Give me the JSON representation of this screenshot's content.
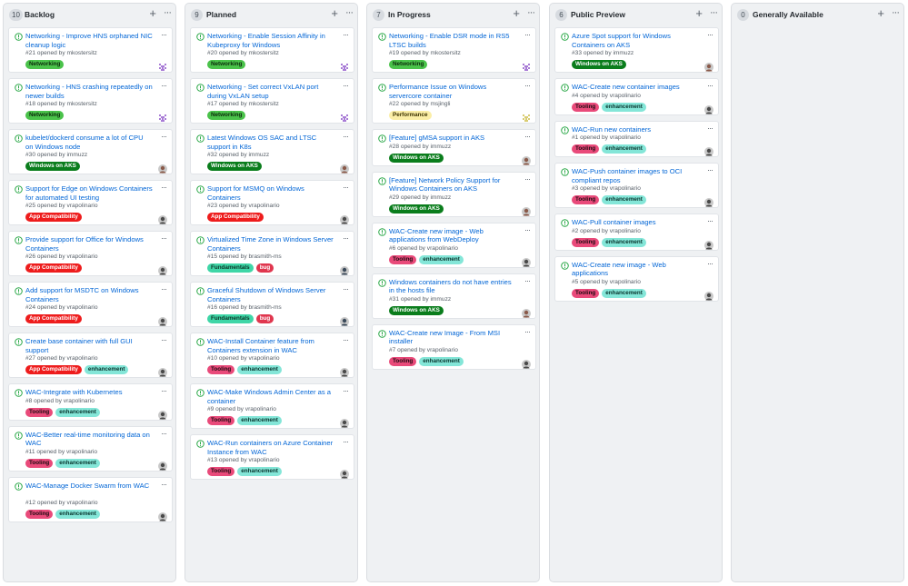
{
  "colors": {
    "link": "#0366d6",
    "open_icon": "#28a745",
    "column_bg": "#eff1f3"
  },
  "icons": {
    "open_issue": "issue-opened-icon",
    "add": "plus-icon",
    "more": "kebab-horizontal-icon"
  },
  "labels": {
    "Networking": {
      "bg": "#4ac24a",
      "fg": "#0b2a0b"
    },
    "Windows on AKS": {
      "bg": "#0a7d1c",
      "fg": "#ffffff"
    },
    "App Compatibility": {
      "bg": "#ee1c1c",
      "fg": "#ffffff"
    },
    "Tooling": {
      "bg": "#e94a7a",
      "fg": "#1b0a10"
    },
    "enhancement": {
      "bg": "#84e6d8",
      "fg": "#08332c"
    },
    "Fundamentals": {
      "bg": "#3fd6a7",
      "fg": "#0b3326"
    },
    "bug": {
      "bg": "#e0364e",
      "fg": "#ffffff"
    },
    "Performance": {
      "bg": "#fbeea6",
      "fg": "#3b3100"
    }
  },
  "columns": [
    {
      "title": "Backlog",
      "count": "10",
      "add_icon": "+",
      "menu_icon": "···",
      "cards": [
        {
          "title": "Networking - Improve HNS orphaned NIC cleanup logic",
          "meta": "#21 opened by mkostersitz",
          "labels": [
            "Networking"
          ],
          "avatar": "identicon-purple"
        },
        {
          "title": "Networking - HNS crashing repeatedly on newer builds",
          "meta": "#18 opened by mkostersitz",
          "labels": [
            "Networking"
          ],
          "avatar": "identicon-purple"
        },
        {
          "title": "kubelet/dockerd consume a lot of CPU on Windows node",
          "meta": "#30 opened by immuzz",
          "labels": [
            "Windows on AKS"
          ],
          "avatar": "photo-immuzz"
        },
        {
          "title": "Support for Edge on Windows Containers for automated UI testing",
          "meta": "#25 opened by vrapolinario",
          "labels": [
            "App Compatibility"
          ],
          "avatar": "photo-vrapolinario"
        },
        {
          "title": "Provide support for Office for Windows Containers",
          "meta": "#26 opened by vrapolinario",
          "labels": [
            "App Compatibility"
          ],
          "avatar": "photo-vrapolinario"
        },
        {
          "title": "Add support for MSDTC on Windows Containers",
          "meta": "#24 opened by vrapolinario",
          "labels": [
            "App Compatibility"
          ],
          "avatar": "photo-vrapolinario"
        },
        {
          "title": "Create base container with full GUI support",
          "meta": "#27 opened by vrapolinario",
          "labels": [
            "App Compatibility",
            "enhancement"
          ],
          "avatar": "photo-vrapolinario"
        },
        {
          "title": "WAC-Integrate with Kubernetes",
          "meta": "#8 opened by vrapolinario",
          "labels": [
            "Tooling",
            "enhancement"
          ],
          "avatar": "photo-vrapolinario"
        },
        {
          "title": "WAC-Better real-time monitoring data on WAC",
          "meta": "#11 opened by vrapolinario",
          "labels": [
            "Tooling",
            "enhancement"
          ],
          "avatar": "photo-vrapolinario"
        },
        {
          "title": "WAC-Manage Docker Swarm from WAC",
          "meta": "#12 opened by vrapolinario",
          "labels": [
            "Tooling",
            "enhancement"
          ],
          "avatar": "photo-vrapolinario"
        }
      ]
    },
    {
      "title": "Planned",
      "count": "9",
      "add_icon": "+",
      "menu_icon": "···",
      "cards": [
        {
          "title": "Networking - Enable Session Affinity in Kubeproxy for Windows",
          "meta": "#20 opened by mkostersitz",
          "labels": [
            "Networking"
          ],
          "avatar": "identicon-purple"
        },
        {
          "title": "Networking - Set correct VxLAN port during VxLAN setup",
          "meta": "#17 opened by mkostersitz",
          "labels": [
            "Networking"
          ],
          "avatar": "identicon-purple"
        },
        {
          "title": "Latest Windows OS SAC and LTSC support in K8s",
          "meta": "#32 opened by immuzz",
          "labels": [
            "Windows on AKS"
          ],
          "avatar": "photo-immuzz"
        },
        {
          "title": "Support for MSMQ on Windows Containers",
          "meta": "#23 opened by vrapolinario",
          "labels": [
            "App Compatibility"
          ],
          "avatar": "photo-vrapolinario"
        },
        {
          "title": "Virtualized Time Zone in Windows Server Containers",
          "meta": "#15 opened by brasmith-ms",
          "labels": [
            "Fundamentals",
            "bug"
          ],
          "avatar": "photo-brasmith"
        },
        {
          "title": "Graceful Shutdown of Windows Server Containers",
          "meta": "#16 opened by brasmith-ms",
          "labels": [
            "Fundamentals",
            "bug"
          ],
          "avatar": "photo-brasmith"
        },
        {
          "title": "WAC-Install Container feature from Containers extension in WAC",
          "meta": "#10 opened by vrapolinario",
          "labels": [
            "Tooling",
            "enhancement"
          ],
          "avatar": "photo-vrapolinario"
        },
        {
          "title": "WAC-Make Windows Admin Center as a container",
          "meta": "#9 opened by vrapolinario",
          "labels": [
            "Tooling",
            "enhancement"
          ],
          "avatar": "photo-vrapolinario"
        },
        {
          "title": "WAC-Run containers on Azure Container Instance from WAC",
          "meta": "#13 opened by vrapolinario",
          "labels": [
            "Tooling",
            "enhancement"
          ],
          "avatar": "photo-vrapolinario"
        }
      ]
    },
    {
      "title": "In Progress",
      "count": "7",
      "add_icon": "+",
      "menu_icon": "···",
      "cards": [
        {
          "title": "Networking - Enable DSR mode in RS5 LTSC builds",
          "meta": "#19 opened by mkostersitz",
          "labels": [
            "Networking"
          ],
          "avatar": "identicon-purple"
        },
        {
          "title": "Performance Issue on Windows servercore container",
          "meta": "#22 opened by msjingli",
          "labels": [
            "Performance"
          ],
          "avatar": "identicon-yellow"
        },
        {
          "title": "[Feature] gMSA support in AKS",
          "meta": "#28 opened by immuzz",
          "labels": [
            "Windows on AKS"
          ],
          "avatar": "photo-immuzz"
        },
        {
          "title": "[Feature] Network Policy Support for Windows Containers on AKS",
          "meta": "#29 opened by immuzz",
          "labels": [
            "Windows on AKS"
          ],
          "avatar": "photo-immuzz"
        },
        {
          "title": "WAC-Create new image - Web applications from WebDeploy",
          "meta": "#6 opened by vrapolinario",
          "labels": [
            "Tooling",
            "enhancement"
          ],
          "avatar": "photo-vrapolinario"
        },
        {
          "title": "Windows containers do not have entries in the hosts file",
          "meta": "#31 opened by immuzz",
          "labels": [
            "Windows on AKS"
          ],
          "avatar": "photo-immuzz"
        },
        {
          "title": "WAC-Create new Image - From MSI installer",
          "meta": "#7 opened by vrapolinario",
          "labels": [
            "Tooling",
            "enhancement"
          ],
          "avatar": "photo-vrapolinario"
        }
      ]
    },
    {
      "title": "Public Preview",
      "count": "6",
      "add_icon": "+",
      "menu_icon": "···",
      "cards": [
        {
          "title": "Azure Spot support for Windows Containers on AKS",
          "meta": "#33 opened by immuzz",
          "labels": [
            "Windows on AKS"
          ],
          "avatar": "photo-immuzz"
        },
        {
          "title": "WAC-Create new container images",
          "meta": "#4 opened by vrapolinario",
          "labels": [
            "Tooling",
            "enhancement"
          ],
          "avatar": "photo-vrapolinario"
        },
        {
          "title": "WAC-Run new containers",
          "meta": "#1 opened by vrapolinario",
          "labels": [
            "Tooling",
            "enhancement"
          ],
          "avatar": "photo-vrapolinario"
        },
        {
          "title": "WAC-Push container images to OCI compliant repos",
          "meta": "#3 opened by vrapolinario",
          "labels": [
            "Tooling",
            "enhancement"
          ],
          "avatar": "photo-vrapolinario"
        },
        {
          "title": "WAC-Pull container images",
          "meta": "#2 opened by vrapolinario",
          "labels": [
            "Tooling",
            "enhancement"
          ],
          "avatar": "photo-vrapolinario"
        },
        {
          "title": "WAC-Create new image - Web applications",
          "meta": "#5 opened by vrapolinario",
          "labels": [
            "Tooling",
            "enhancement"
          ],
          "avatar": "photo-vrapolinario"
        }
      ]
    },
    {
      "title": "Generally Available",
      "count": "0",
      "add_icon": "+",
      "menu_icon": "···",
      "cards": []
    }
  ]
}
